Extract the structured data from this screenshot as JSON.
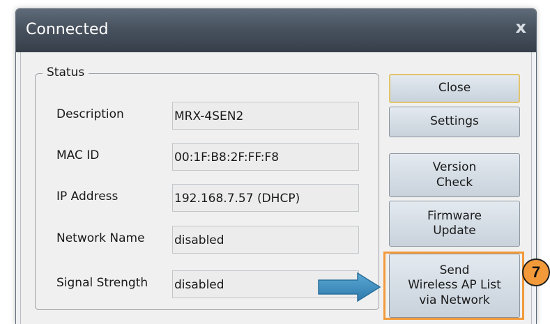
{
  "window": {
    "title": "Connected",
    "close_glyph": "x"
  },
  "status": {
    "legend": "Status",
    "fields": [
      {
        "label": "Description",
        "value": "MRX-4SEN2"
      },
      {
        "label": "MAC ID",
        "value": "00:1F:B8:2F:FF:F8"
      },
      {
        "label": "IP Address",
        "value": "192.168.7.57 (DHCP)"
      },
      {
        "label": "Network Name",
        "value": "disabled"
      },
      {
        "label": "Signal Strength",
        "value": "disabled"
      }
    ]
  },
  "buttons": {
    "close": "Close",
    "settings": "Settings",
    "version_check": "Version\nCheck",
    "firmware_update": "Firmware\nUpdate",
    "send_ap_list": "Send\nWireless AP List\nvia Network"
  },
  "callout": {
    "step_number": "7",
    "highlight_color": "#f29a3a",
    "arrow_color": "#3d8fc0",
    "arrow_icon": "right-arrow-icon"
  }
}
